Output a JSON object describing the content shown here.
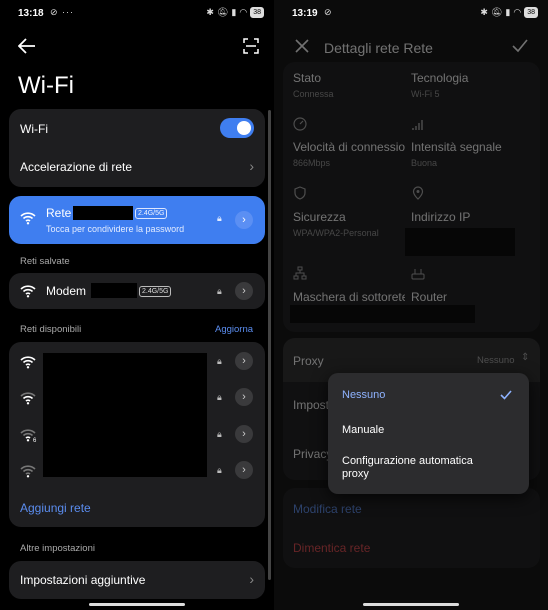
{
  "left": {
    "status": {
      "time": "13:18",
      "battery": "38"
    },
    "header": {
      "title": "Wi-Fi"
    },
    "wifi_toggle_label": "Wi-Fi",
    "accel_label": "Accelerazione di rete",
    "connected": {
      "name": "Rete",
      "band": "2.4G/5G",
      "subtitle": "Tocca per condividere la password"
    },
    "saved_title": "Reti salvate",
    "saved": [
      {
        "name": "Modem",
        "band": "2.4G/5G"
      }
    ],
    "available_title": "Reti disponibili",
    "refresh_label": "Aggiorna",
    "add_network_label": "Aggiungi rete",
    "other_title": "Altre impostazioni",
    "additional_label": "Impostazioni aggiuntive"
  },
  "right": {
    "status": {
      "time": "13:19",
      "battery": "38"
    },
    "header": {
      "title": "Dettagli rete Rete"
    },
    "details": {
      "state_label": "Stato",
      "state_value": "Connessa",
      "tech_label": "Tecnologia",
      "tech_value": "Wi-Fi 5",
      "speed_label": "Velocità di connessione",
      "speed_value": "866Mbps",
      "signal_label": "Intensità segnale",
      "signal_value": "Buona",
      "security_label": "Sicurezza",
      "security_value": "WPA/WPA2-Personal",
      "ip_label": "Indirizzo IP",
      "mask_label": "Maschera di sottorete",
      "router_label": "Router"
    },
    "proxy_label": "Proxy",
    "proxy_value": "Nessuno",
    "ip_settings_label": "Impostazioni IP",
    "privacy_label": "Privacy",
    "modify_label": "Modifica rete",
    "forget_label": "Dimentica rete",
    "dropdown": {
      "options": [
        "Nessuno",
        "Manuale",
        "Configurazione automatica proxy"
      ],
      "selected": "Nessuno"
    }
  },
  "colors": {
    "accent": "#3f7ef0",
    "link": "#5b8def",
    "danger": "#e5484d",
    "card": "#1e1e20"
  }
}
